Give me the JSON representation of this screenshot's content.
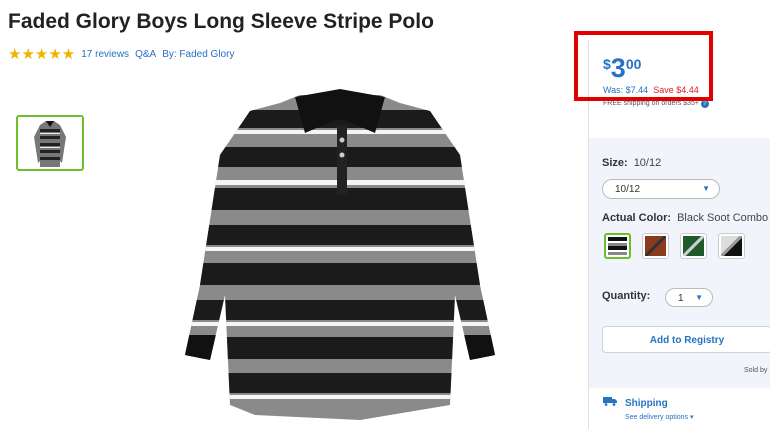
{
  "product": {
    "title": "Faded Glory Boys Long Sleeve Stripe Polo",
    "stars": "★★★★★",
    "reviews": "17 reviews",
    "qa": "Q&A",
    "by": "By: Faded Glory"
  },
  "price": {
    "currency": "$",
    "dollars": "3",
    "cents": "00",
    "was": "Was: $7.44",
    "save": "Save $4.44",
    "shipping_note": "FREE shipping on orders $35+"
  },
  "config": {
    "size_label": "Size:",
    "size_value": "10/12",
    "size_select": "10/12",
    "color_label": "Actual Color:",
    "color_value": "Black Soot Combo",
    "quantity_label": "Quantity:",
    "quantity_value": "1",
    "registry_button": "Add to Registry",
    "sold_by": "Sold by"
  },
  "shipping": {
    "title": "Shipping",
    "options": "See delivery options"
  },
  "colors": {
    "accent": "#2573c2",
    "sale": "#de1c24",
    "selected": "#6bbf2b",
    "highlight": "#e00000"
  }
}
